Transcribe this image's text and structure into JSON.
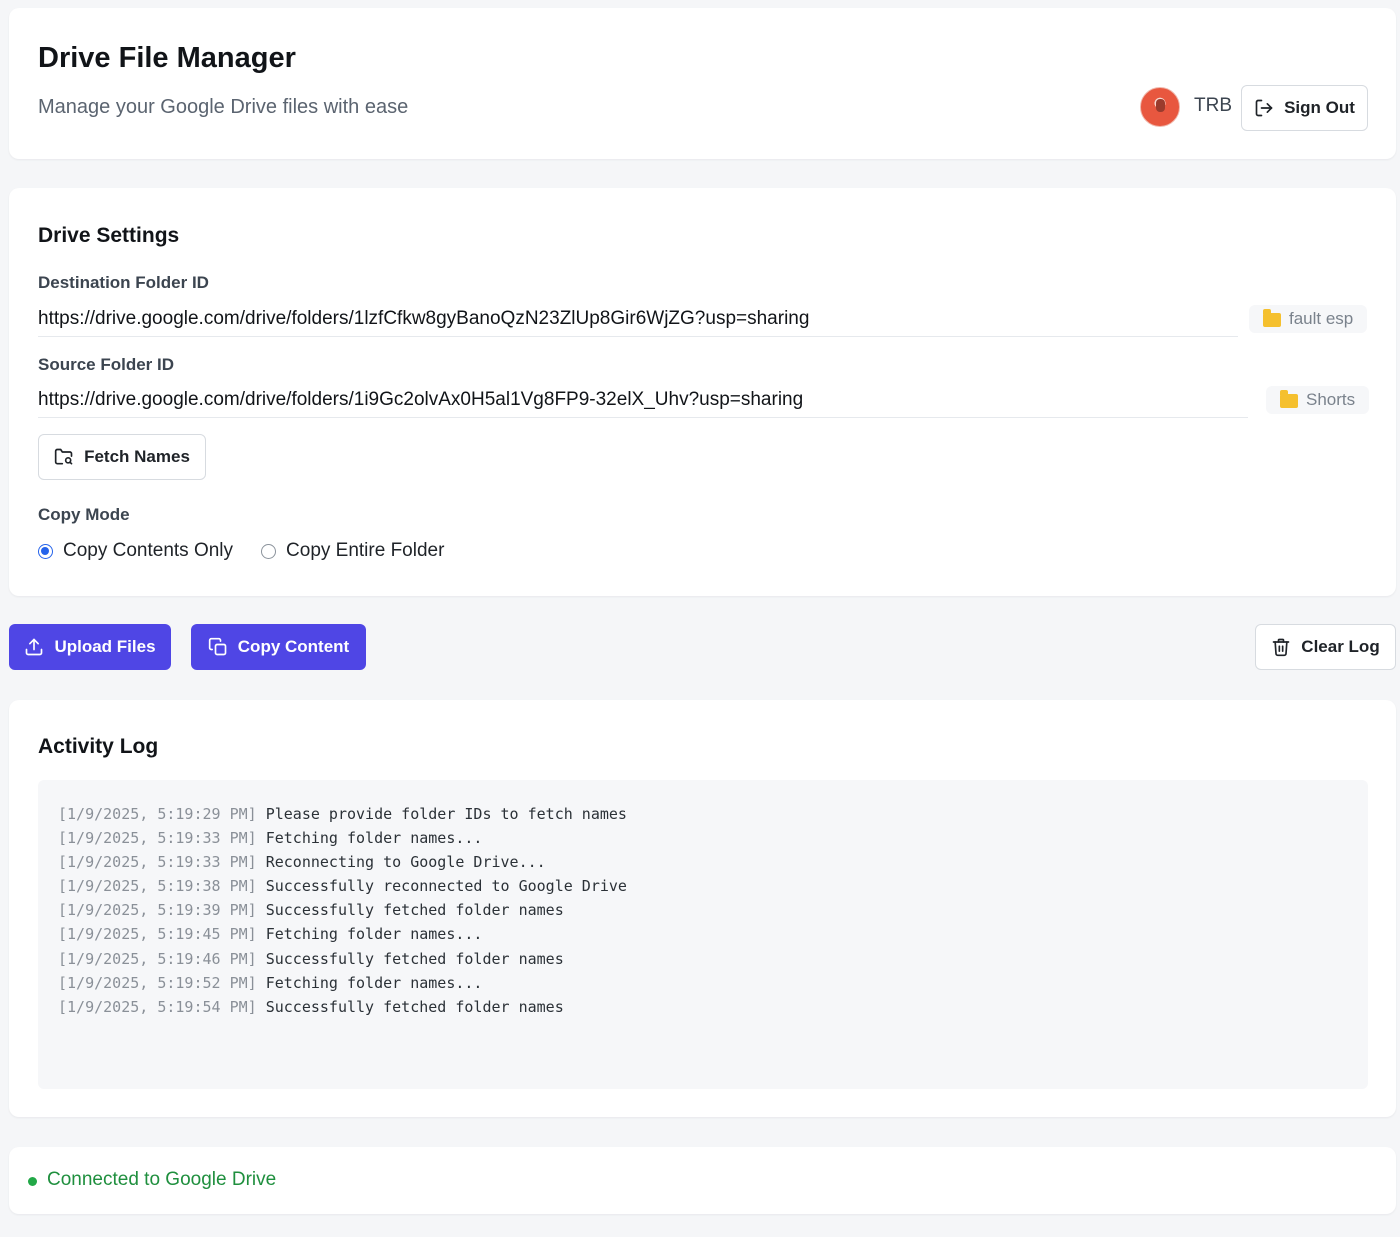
{
  "header": {
    "title": "Drive File Manager",
    "subtitle": "Manage your Google Drive files with ease",
    "user_initials": "TRB",
    "sign_out_label": "Sign Out"
  },
  "settings": {
    "title": "Drive Settings",
    "destination": {
      "label": "Destination Folder ID",
      "value": "https://drive.google.com/drive/folders/1lzfCfkw8gyBanoQzN23ZlUp8Gir6WjZG?usp=sharing",
      "folder_name": "fault esp"
    },
    "source": {
      "label": "Source Folder ID",
      "value": "https://drive.google.com/drive/folders/1i9Gc2olvAx0H5al1Vg8FP9-32elX_Uhv?usp=sharing",
      "folder_name": "Shorts"
    },
    "fetch_label": "Fetch Names",
    "copy_mode": {
      "label": "Copy Mode",
      "options": [
        {
          "label": "Copy Contents Only",
          "selected": true
        },
        {
          "label": "Copy Entire Folder",
          "selected": false
        }
      ]
    }
  },
  "actions": {
    "upload_label": "Upload Files",
    "copy_label": "Copy Content",
    "clear_label": "Clear Log"
  },
  "log": {
    "title": "Activity Log",
    "entries": [
      {
        "ts": "[1/9/2025, 5:19:29 PM]",
        "msg": "Please provide folder IDs to fetch names"
      },
      {
        "ts": "[1/9/2025, 5:19:33 PM]",
        "msg": "Fetching folder names..."
      },
      {
        "ts": "[1/9/2025, 5:19:33 PM]",
        "msg": "Reconnecting to Google Drive..."
      },
      {
        "ts": "[1/9/2025, 5:19:38 PM]",
        "msg": "Successfully reconnected to Google Drive"
      },
      {
        "ts": "[1/9/2025, 5:19:39 PM]",
        "msg": "Successfully fetched folder names"
      },
      {
        "ts": "[1/9/2025, 5:19:45 PM]",
        "msg": "Fetching folder names..."
      },
      {
        "ts": "[1/9/2025, 5:19:46 PM]",
        "msg": "Successfully fetched folder names"
      },
      {
        "ts": "[1/9/2025, 5:19:52 PM]",
        "msg": "Fetching folder names..."
      },
      {
        "ts": "[1/9/2025, 5:19:54 PM]",
        "msg": "Successfully fetched folder names"
      }
    ]
  },
  "status": {
    "text": "Connected to Google Drive",
    "color": "#22a847"
  },
  "colors": {
    "primary": "#4f46e5",
    "radio_accent": "#2563eb",
    "folder": "#f5c02e"
  },
  "icons": {
    "sign_out": "sign-out-icon",
    "fetch": "folder-search-icon",
    "upload": "upload-icon",
    "copy": "copy-icon",
    "clear": "trash-icon",
    "folder": "folder-icon"
  }
}
